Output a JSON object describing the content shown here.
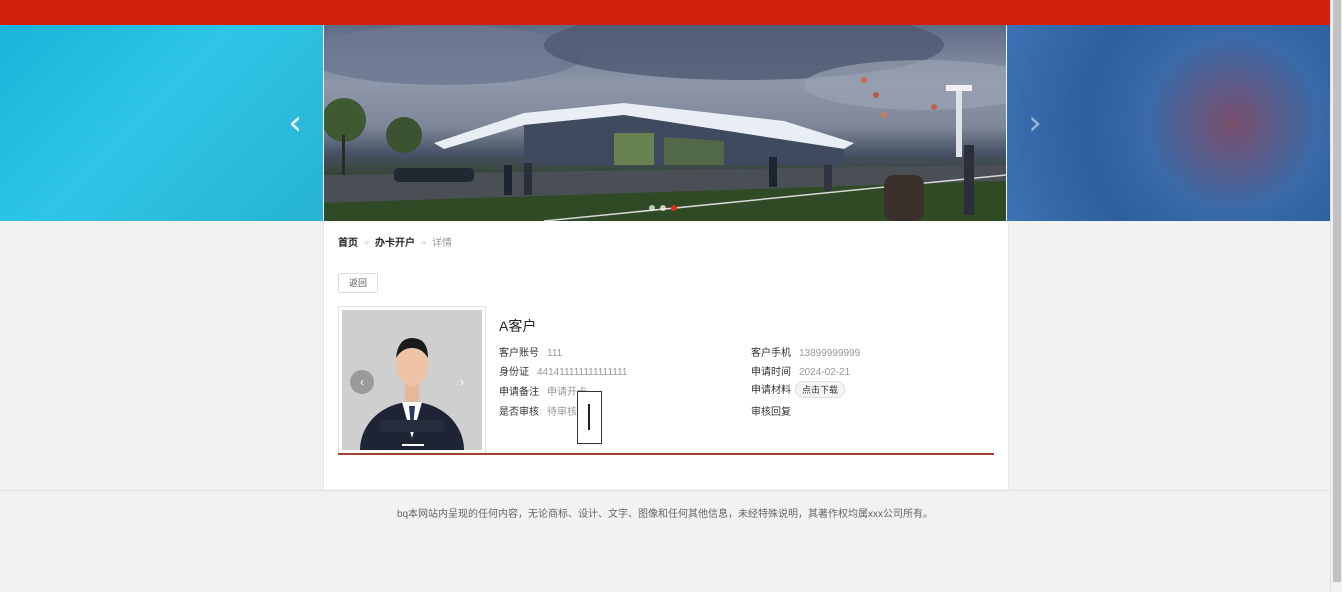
{
  "banner": {
    "prev_label": "‹",
    "next_label": "›",
    "slide_count": 3,
    "active_slide": 3
  },
  "breadcrumb": {
    "home": "首页",
    "section": "办卡开户",
    "current": "详情",
    "separator": "»"
  },
  "back_button": "返回",
  "customer": {
    "name": "A客户",
    "account_label": "客户账号",
    "account_value": "111",
    "phone_label": "客户手机",
    "phone_value": "13899999999",
    "id_label": "身份证",
    "id_value": "441411111111111111",
    "time_label": "申请时间",
    "time_value": "2024-02-21",
    "note_label": "申请备注",
    "note_value": "申请开卡",
    "material_label": "申请材料",
    "download_label": "点击下载",
    "review_label": "是否审核",
    "review_value": "待审核",
    "reply_label": "审核回复"
  },
  "photo": {
    "prev_label": "‹",
    "next_label": "›"
  },
  "footer": {
    "text": "bq本网站内呈现的任何内容，无论商标、设计、文字、图像和任何其他信息，未经特殊说明，其著作权均属xxx公司所有。"
  },
  "colors": {
    "top_bar": "#d4200f",
    "accent_divider": "#a1422f",
    "active_dot": "#e02a1a"
  }
}
